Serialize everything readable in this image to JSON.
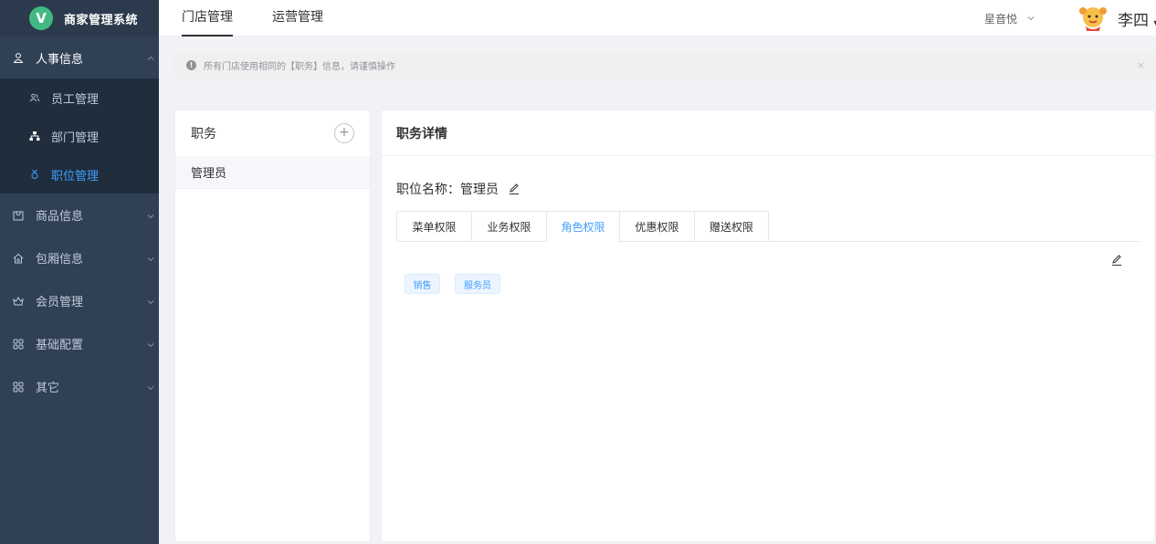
{
  "app": {
    "logo_letter": "V",
    "title": "商家管理系统"
  },
  "sidebar": {
    "groups": [
      {
        "label": "人事信息",
        "icon": "user-icon",
        "open": true,
        "items": [
          {
            "label": "员工管理",
            "icon": "people-icon"
          },
          {
            "label": "部门管理",
            "icon": "org-icon"
          },
          {
            "label": "职位管理",
            "icon": "badge-icon",
            "active": true
          }
        ]
      },
      {
        "label": "商品信息",
        "icon": "goods-icon"
      },
      {
        "label": "包厢信息",
        "icon": "room-icon"
      },
      {
        "label": "会员管理",
        "icon": "member-icon"
      },
      {
        "label": "基础配置",
        "icon": "grid-icon"
      },
      {
        "label": "其它",
        "icon": "grid-icon"
      }
    ]
  },
  "header": {
    "tabs": [
      {
        "label": "门店管理",
        "active": true
      },
      {
        "label": "运营管理"
      }
    ],
    "store": "星音悦",
    "user": "李四"
  },
  "alert": {
    "text": "所有门店使用相同的【职务】信息，请谨慎操作",
    "close": "×"
  },
  "left_panel": {
    "title": "职务",
    "add": "+",
    "items": [
      "管理员"
    ]
  },
  "detail": {
    "title": "职务详情",
    "position_label": "职位名称：",
    "position_value": "管理员",
    "tabs": [
      {
        "label": "菜单权限"
      },
      {
        "label": "业务权限"
      },
      {
        "label": "角色权限",
        "active": true
      },
      {
        "label": "优惠权限"
      },
      {
        "label": "赠送权限"
      }
    ],
    "roles": [
      "销售",
      "服务员"
    ]
  },
  "colors": {
    "sidebar_bg": "#304156",
    "submenu_bg": "#1f2d3d",
    "accent": "#409eff",
    "logo": "#42b983"
  }
}
